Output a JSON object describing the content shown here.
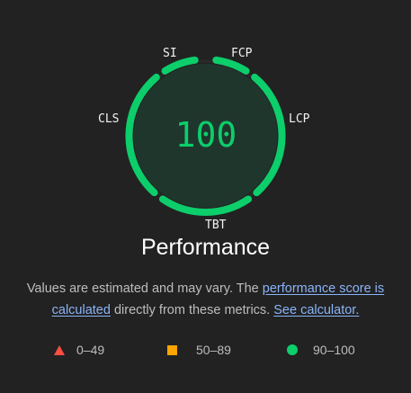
{
  "gauge": {
    "score": "100",
    "title": "Performance",
    "color_pass": "#0cce6b",
    "metrics": {
      "si": "SI",
      "fcp": "FCP",
      "lcp": "LCP",
      "tbt": "TBT",
      "cls": "CLS"
    }
  },
  "description": {
    "text_before": "Values are estimated and may vary. The ",
    "link_score": "performance score is calculated",
    "text_middle": " directly from these metrics. ",
    "link_calculator": "See calculator."
  },
  "legend": {
    "fail": {
      "range": "0–49",
      "color": "#ff4e42",
      "icon": "triangle-icon"
    },
    "average": {
      "range": "50–89",
      "color": "#ffa400",
      "icon": "square-icon"
    },
    "pass": {
      "range": "90–100",
      "color": "#0cce6b",
      "icon": "circle-icon"
    }
  }
}
